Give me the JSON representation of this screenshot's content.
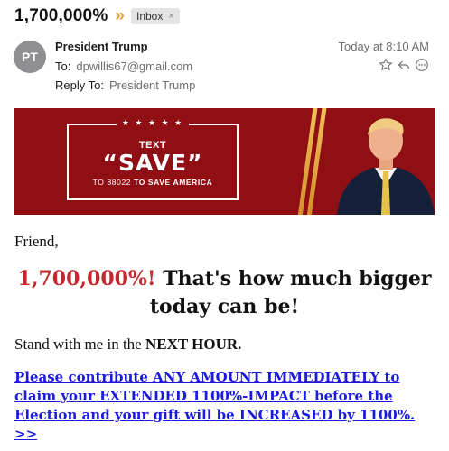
{
  "email": {
    "subject": "1,700,000%",
    "chevrons": "»",
    "mailbox_badge": "Inbox",
    "badge_close": "×",
    "avatar_initials": "PT",
    "from_name": "President Trump",
    "to_label": "To:",
    "to_value": "dpwillis67@gmail.com",
    "reply_to_label": "Reply To:",
    "reply_to_value": "President Trump",
    "date": "Today at 8:10 AM",
    "action_icons": [
      "star-icon",
      "reply-icon",
      "more-icon"
    ]
  },
  "banner": {
    "stars": "★ ★ ★ ★ ★",
    "text_label": "TEXT",
    "keyword": "“SAVE”",
    "cta_prefix": "TO 88022",
    "cta_suffix": "TO SAVE AMERICA"
  },
  "body": {
    "greeting": "Friend,",
    "headline_highlight": "1,700,000%!",
    "headline_rest": "That's how much bigger today can be!",
    "stand_prefix": "Stand with me in the",
    "stand_bold": "NEXT HOUR.",
    "donate_link": "Please contribute ANY AMOUNT IMMEDIATELY to claim your EXTENDED 1100%-IMPACT  before the Election and your gift will be INCREASED by 1100%. >>"
  },
  "colors": {
    "banner_red": "#8f0f14",
    "headline_red": "#c5282f",
    "link_blue": "#1a1ae0",
    "chevron_orange": "#e8a13a"
  }
}
